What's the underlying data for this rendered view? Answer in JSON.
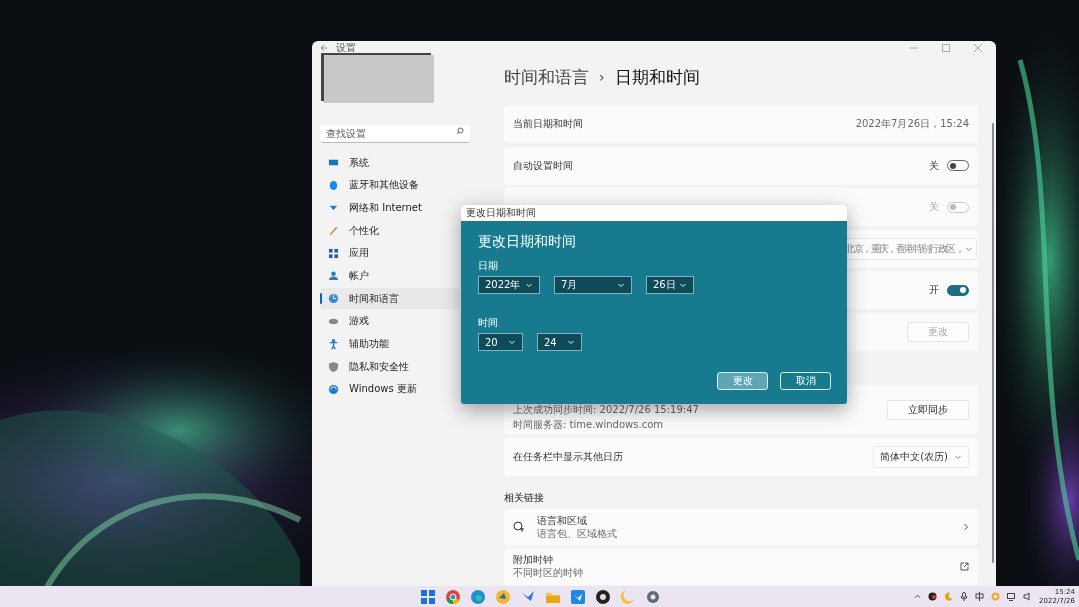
{
  "window": {
    "title": "设置"
  },
  "search": {
    "placeholder": "查找设置"
  },
  "sidebar": {
    "items": [
      {
        "label": "系统",
        "selected": false
      },
      {
        "label": "蓝牙和其他设备",
        "selected": false
      },
      {
        "label": "网络和 Internet",
        "selected": false
      },
      {
        "label": "个性化",
        "selected": false
      },
      {
        "label": "应用",
        "selected": false
      },
      {
        "label": "帐户",
        "selected": false
      },
      {
        "label": "时间和语言",
        "selected": true
      },
      {
        "label": "游戏",
        "selected": false
      },
      {
        "label": "辅助功能",
        "selected": false
      },
      {
        "label": "隐私和安全性",
        "selected": false
      },
      {
        "label": "Windows 更新",
        "selected": false
      }
    ]
  },
  "breadcrumb": {
    "parent": "时间和语言",
    "separator": "›",
    "current": "日期和时间"
  },
  "settings": [
    {
      "kind": "info",
      "label": "当前日期和时间",
      "value": "2022年7月26日，15:24"
    },
    {
      "kind": "toggle",
      "label": "自动设置时间",
      "state_label": "关",
      "on": false,
      "disabled": false
    },
    {
      "kind": "toggle",
      "state_label": "关",
      "on": false,
      "disabled": true
    },
    {
      "kind": "dropdown",
      "value": "北京，重庆，香港特别行政区，"
    },
    {
      "kind": "toggle",
      "state_label": "开",
      "on": true,
      "disabled": false
    },
    {
      "kind": "button",
      "button": "更改",
      "disabled": true
    },
    {
      "kind": "blank"
    },
    {
      "kind": "sync",
      "lines": [
        "上次成功同步时间: 2022/7/26 15:19:47",
        "时间服务器: time.windows.com"
      ],
      "button": "立即同步",
      "disabled": false
    },
    {
      "kind": "dropdown",
      "label": "在任务栏中显示其他日历",
      "value": "简体中文(农历)"
    }
  ],
  "related": {
    "heading": "相关链接",
    "links": [
      {
        "kind": "chevron",
        "label": "语言和区域",
        "sublabel": "语言包、区域格式"
      },
      {
        "kind": "external",
        "label": "附加时钟",
        "sublabel": "不同时区的时钟"
      }
    ]
  },
  "dialog": {
    "title": "更改日期和时间",
    "heading": "更改日期和时间",
    "date_label": "日期",
    "date_fields": [
      "2022年",
      "7月",
      "26日"
    ],
    "time_label": "时间",
    "time_fields": [
      "20",
      "24"
    ],
    "buttons": [
      {
        "label": "更改",
        "hovered": true
      },
      {
        "label": "取消",
        "hovered": false
      }
    ]
  },
  "taskbar": {
    "time": "15:24",
    "date": "2022/7/26"
  }
}
